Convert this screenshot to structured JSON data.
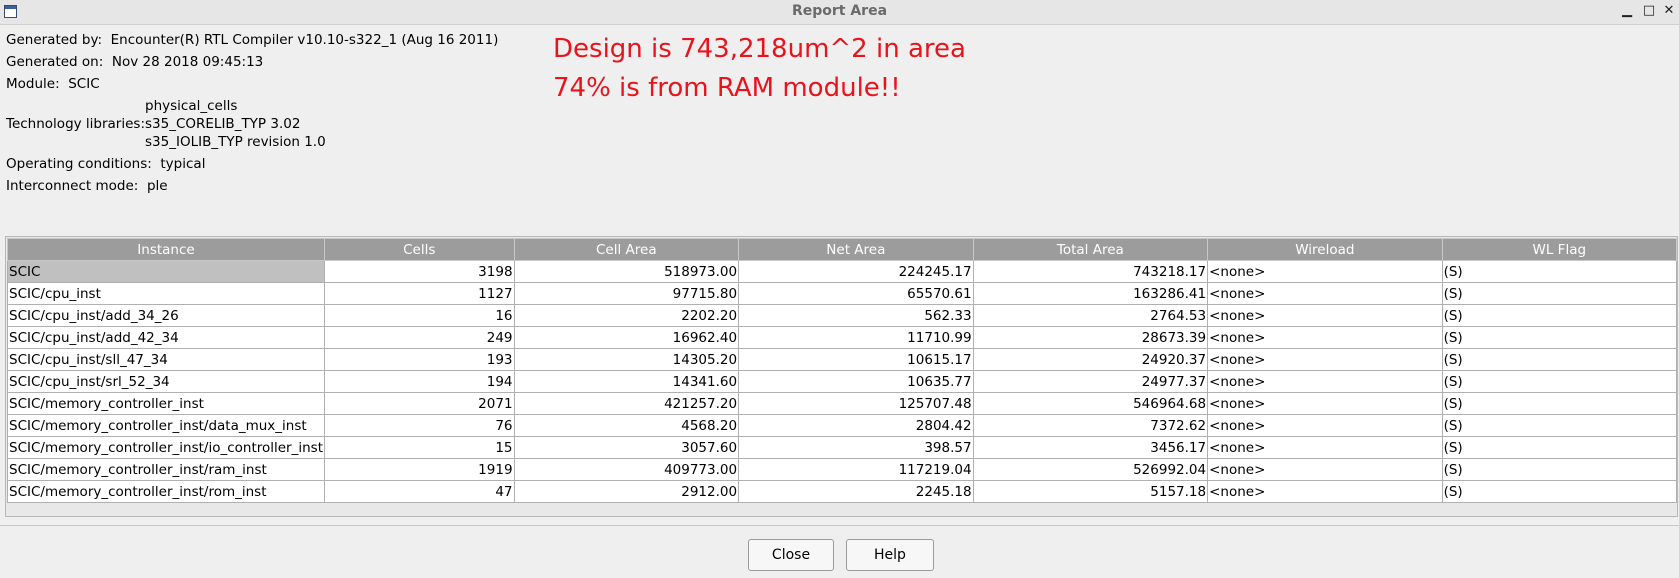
{
  "window": {
    "title": "Report Area",
    "minimize": "▁",
    "maximize": "□",
    "close": "✕"
  },
  "info": {
    "generated_by_label": "Generated by:",
    "generated_by": "Encounter(R) RTL Compiler v10.10-s322_1 (Aug 16 2011)",
    "generated_on_label": "Generated on:",
    "generated_on": "Nov 28 2018 09:45:13",
    "module_label": "Module:",
    "module": "SCIC",
    "tech_label": "Technology libraries:",
    "tech_libs": [
      "physical_cells",
      "s35_CORELIB_TYP 3.02",
      "s35_IOLIB_TYP revision 1.0"
    ],
    "operating_label": "Operating conditions:",
    "operating": "typical",
    "interconnect_label": "Interconnect mode:",
    "interconnect": "ple"
  },
  "annotation": {
    "line1": "Design is 743,218um^2 in area",
    "line2": "74% is from RAM module!!",
    "color": "#e8141c"
  },
  "table": {
    "headers": [
      "Instance",
      "Cells",
      "Cell Area",
      "Net Area",
      "Total Area",
      "Wireload",
      "WL Flag"
    ],
    "rows": [
      [
        "SCIC",
        "3198",
        "518973.00",
        "224245.17",
        "743218.17",
        "<none>",
        "(S)"
      ],
      [
        "SCIC/cpu_inst",
        "1127",
        "97715.80",
        "65570.61",
        "163286.41",
        "<none>",
        "(S)"
      ],
      [
        "SCIC/cpu_inst/add_34_26",
        "16",
        "2202.20",
        "562.33",
        "2764.53",
        "<none>",
        "(S)"
      ],
      [
        "SCIC/cpu_inst/add_42_34",
        "249",
        "16962.40",
        "11710.99",
        "28673.39",
        "<none>",
        "(S)"
      ],
      [
        "SCIC/cpu_inst/sll_47_34",
        "193",
        "14305.20",
        "10615.17",
        "24920.37",
        "<none>",
        "(S)"
      ],
      [
        "SCIC/cpu_inst/srl_52_34",
        "194",
        "14341.60",
        "10635.77",
        "24977.37",
        "<none>",
        "(S)"
      ],
      [
        "SCIC/memory_controller_inst",
        "2071",
        "421257.20",
        "125707.48",
        "546964.68",
        "<none>",
        "(S)"
      ],
      [
        "SCIC/memory_controller_inst/data_mux_inst",
        "76",
        "4568.20",
        "2804.42",
        "7372.62",
        "<none>",
        "(S)"
      ],
      [
        "SCIC/memory_controller_inst/io_controller_inst",
        "15",
        "3057.60",
        "398.57",
        "3456.17",
        "<none>",
        "(S)"
      ],
      [
        "SCIC/memory_controller_inst/ram_inst",
        "1919",
        "409773.00",
        "117219.04",
        "526992.04",
        "<none>",
        "(S)"
      ],
      [
        "SCIC/memory_controller_inst/rom_inst",
        "47",
        "2912.00",
        "2245.18",
        "5157.18",
        "<none>",
        "(S)"
      ]
    ]
  },
  "buttons": {
    "close": "Close",
    "help": "Help"
  }
}
